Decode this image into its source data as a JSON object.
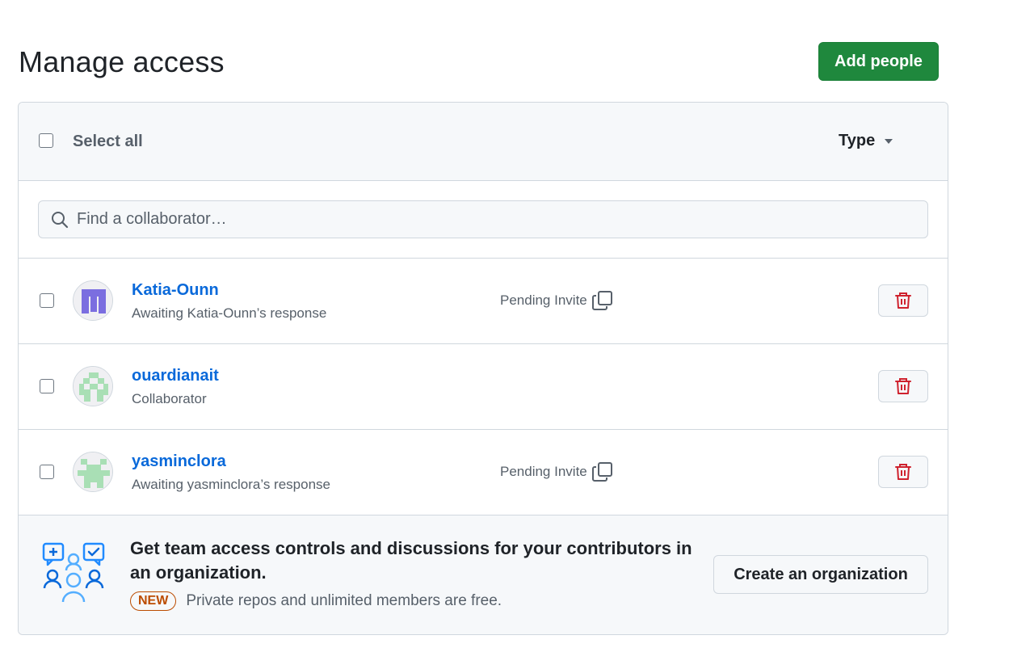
{
  "page": {
    "title": "Manage access"
  },
  "header": {
    "add_people_label": "Add people"
  },
  "toolbar": {
    "select_all_label": "Select all",
    "type_filter_label": "Type"
  },
  "search": {
    "placeholder": "Find a collaborator…"
  },
  "collaborators": [
    {
      "username": "Katia-Ounn",
      "status": "Awaiting Katia-Ounn’s response",
      "pending_label": "Pending Invite"
    },
    {
      "username": "ouardianait",
      "status": "Collaborator",
      "pending_label": ""
    },
    {
      "username": "yasminclora",
      "status": "Awaiting yasminclora’s response",
      "pending_label": "Pending Invite"
    }
  ],
  "promo": {
    "title": "Get team access controls and discussions for your contributors in an organization.",
    "badge": "NEW",
    "subtitle": "Private repos and unlimited members are free.",
    "button_label": "Create an organization"
  },
  "colors": {
    "primary_button": "#1f883d",
    "link": "#0969da",
    "danger": "#cf222e",
    "badge": "#bc4c00",
    "muted": "#57606a"
  },
  "icons": [
    "search-icon",
    "copy-icon",
    "trash-icon",
    "caret-down-icon",
    "team-illustration-icon"
  ]
}
